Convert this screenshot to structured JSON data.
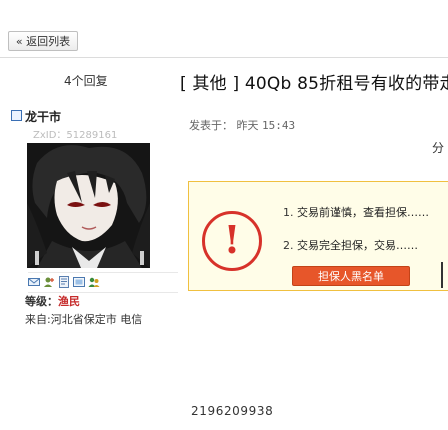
{
  "toolbar": {
    "back_label": "« 返回列表"
  },
  "header": {
    "reply_count": "4个回复",
    "title": "[ 其他 ] 40Qb 85折租号有收的带走"
  },
  "author": {
    "name": "龙干市",
    "zx_id": "ZxID：51289161",
    "rank_label": "等级：",
    "rank_value": "渔民",
    "footer_text": "来自:河北省保定市 电信"
  },
  "post": {
    "time_label": "发表于：",
    "time_day": "昨天",
    "time_clock": "15:43",
    "content": "2196209938"
  },
  "right_edge_char": "分",
  "alert": {
    "line1_num": "1.",
    "line1_text": "交易前谨慎，查看担保……",
    "line2_num": "2.",
    "line2_text": "交易完全担保，交易……",
    "blacklist_button": "担保人黑名单",
    "icon_char": "!",
    "accent_color": "#d7322a"
  },
  "icons": [
    "mail-icon",
    "add-friend-icon",
    "profile-icon",
    "album-icon",
    "group-icon"
  ]
}
